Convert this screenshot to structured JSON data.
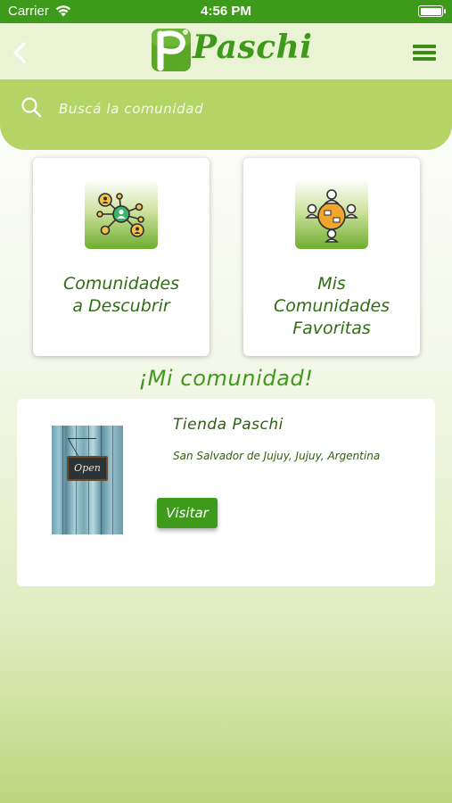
{
  "status_bar": {
    "carrier": "Carrier",
    "time": "4:56 PM"
  },
  "header": {
    "logo_text": "Paschi"
  },
  "search": {
    "placeholder": "Buscá la comunidad"
  },
  "cards": [
    {
      "line1": "Comunidades",
      "line2": "a Descubrir",
      "icon": "network-people-icon"
    },
    {
      "line1": "Mis",
      "line2": "Comunidades",
      "line3": "Favoritas",
      "icon": "meeting-table-icon"
    }
  ],
  "section_title": "¡Mi comunidad!",
  "community": {
    "name": "Tienda Paschi",
    "location": "San Salvador de Jujuy, Jujuy, Argentina",
    "button_label": "Visitar",
    "image_sign_text": "Open"
  },
  "colors": {
    "primary": "#3e9a1a",
    "search_band": "#b5d466",
    "header_bg": "#eaf3d4"
  }
}
